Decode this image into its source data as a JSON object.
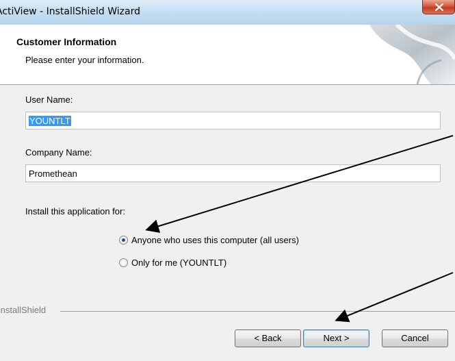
{
  "window": {
    "title": "ActiView - InstallShield Wizard"
  },
  "header": {
    "title": "Customer Information",
    "subtitle": "Please enter your information."
  },
  "form": {
    "user_name_label": "User Name:",
    "user_name_value": "YOUNTLT",
    "company_name_label": "Company Name:",
    "company_name_value": "Promethean",
    "install_for_label": "Install this application for:",
    "options": [
      {
        "label": "Anyone who uses this computer (all users)",
        "selected": true
      },
      {
        "label": "Only for me (YOUNTLT)",
        "selected": false
      }
    ]
  },
  "footer": {
    "brand": "InstallShield",
    "back_label": "< Back",
    "next_label": "Next >",
    "cancel_label": "Cancel"
  },
  "colors": {
    "selection": "#3399ff",
    "annotation_arrow": "#000000"
  }
}
